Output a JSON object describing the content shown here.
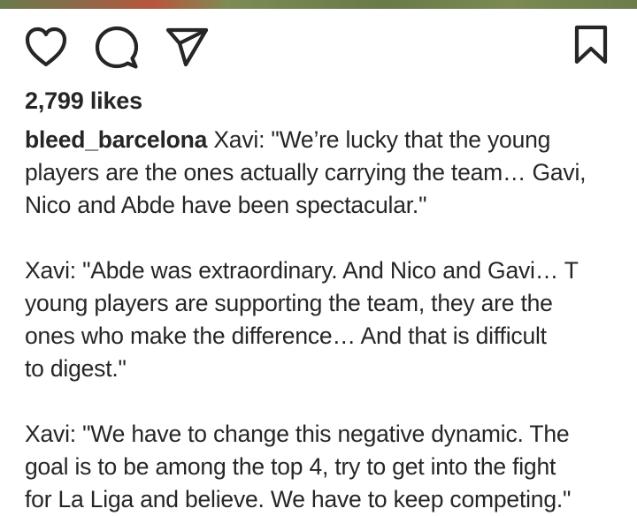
{
  "post": {
    "likes_text": "2,799 likes",
    "username": "bleed_barcelona",
    "caption_first": "Xavi: \"We’re lucky that the young\nplayers are the ones actually carrying the team… Gavi,\nNico and Abde have been spectacular.\"",
    "caption_paragraphs": [
      "Xavi: \"Abde was extraordinary. And Nico and Gavi… T\nyoung players are supporting the team, they are the\nones who make the difference… And that is difficult\nto digest.\"",
      "Xavi: \"We have to change this negative dynamic. The\ngoal is to be among the top 4, try to get into the fight\nfor La Liga and believe. We have to keep competing.\""
    ]
  },
  "icons": {
    "like": "heart-icon",
    "comment": "comment-bubble-icon",
    "share": "paper-plane-icon",
    "save": "bookmark-icon"
  }
}
